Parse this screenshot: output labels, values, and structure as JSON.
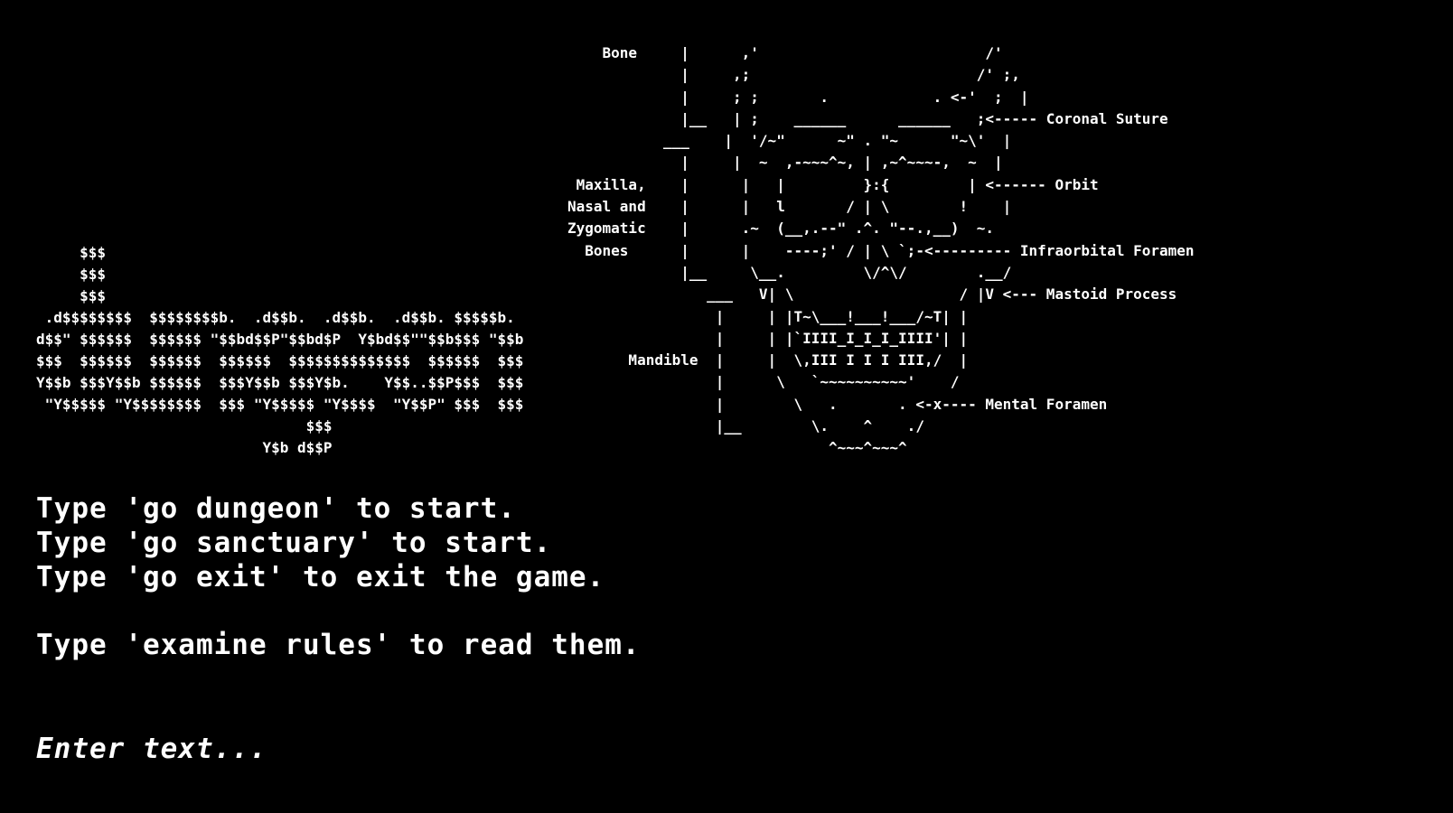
{
  "screen": {
    "background_color": "#000000",
    "text_color": "#ffffff"
  },
  "ascii_logo": {
    "lines": [
      "     $$$",
      "     $$$",
      "     $$$",
      " .d$$$$$$$$  $$$$$$$$b.  .d$$b.  .d$$b.  .d$$b. $$$$$b.",
      "d$$\" $$$$$$  $$$$$$ \"$$bd$$P\"$$bd$P  Y$bd$$\"\"$$b$$$ \"$$b",
      "$$$  $$$$$$  $$$$$$  $$$$$$  $$$$$$$$$$$$$$  $$$$$$  $$$",
      "Y$$b $$$Y$$b $$$$$$  $$$Y$$b $$$Y$b.    Y$$..$$P$$$  $$$",
      " \"Y$$$$$ \"Y$$$$$$$$  $$$ \"Y$$$$$ \"Y$$$$  \"Y$$P\" $$$  $$$",
      "                               $$$",
      "                          Y$b d$$P"
    ]
  },
  "skull_diagram": {
    "lines": [
      "    Bone     |      ,'                          /'",
      "             |     ,;                          /' ;,",
      "             |     ; ;       .            . <-'  ;  |",
      "             |__   | ;    ______      ______   ;<----- Coronal Suture",
      "           ___    |  '/~\"      ~\" . \"~      \"~\\'  |",
      "             |     |  ~  ,-~~~^~, | ,~^~~~-,  ~  |",
      " Maxilla,    |      |   |         }:{         | <------ Orbit",
      "Nasal and    |      |   l       / | \\        !    |",
      "Zygomatic    |      .~  (__,.--\" .^. \"--.,__)  ~.",
      "  Bones      |      |    ----;' / | \\ `;-<--------- Infraorbital Foramen",
      "             |__     \\__.         \\/^\\/        .__/",
      "                ___   V| \\                   / |V <--- Mastoid Process",
      "                 |     | |T~\\___!___!___/~T| |",
      "                 |     | |`IIII_I_I_I_IIII'| |",
      "       Mandible  |     |  \\,III I I I III,/  |",
      "                 |      \\   `~~~~~~~~~~'    /",
      "                 |        \\   .       . <-x---- Mental Foramen",
      "                 |__        \\.    ^    ./",
      "                              ^~~~^~~~^"
    ]
  },
  "messages": {
    "line1": "Type 'go dungeon' to start.",
    "line2": "Type 'go sanctuary' to start.",
    "line3": "Type 'go exit' to exit the game.",
    "line4": "Type 'examine rules' to read them."
  },
  "input": {
    "placeholder": "Enter text...",
    "value": ""
  }
}
